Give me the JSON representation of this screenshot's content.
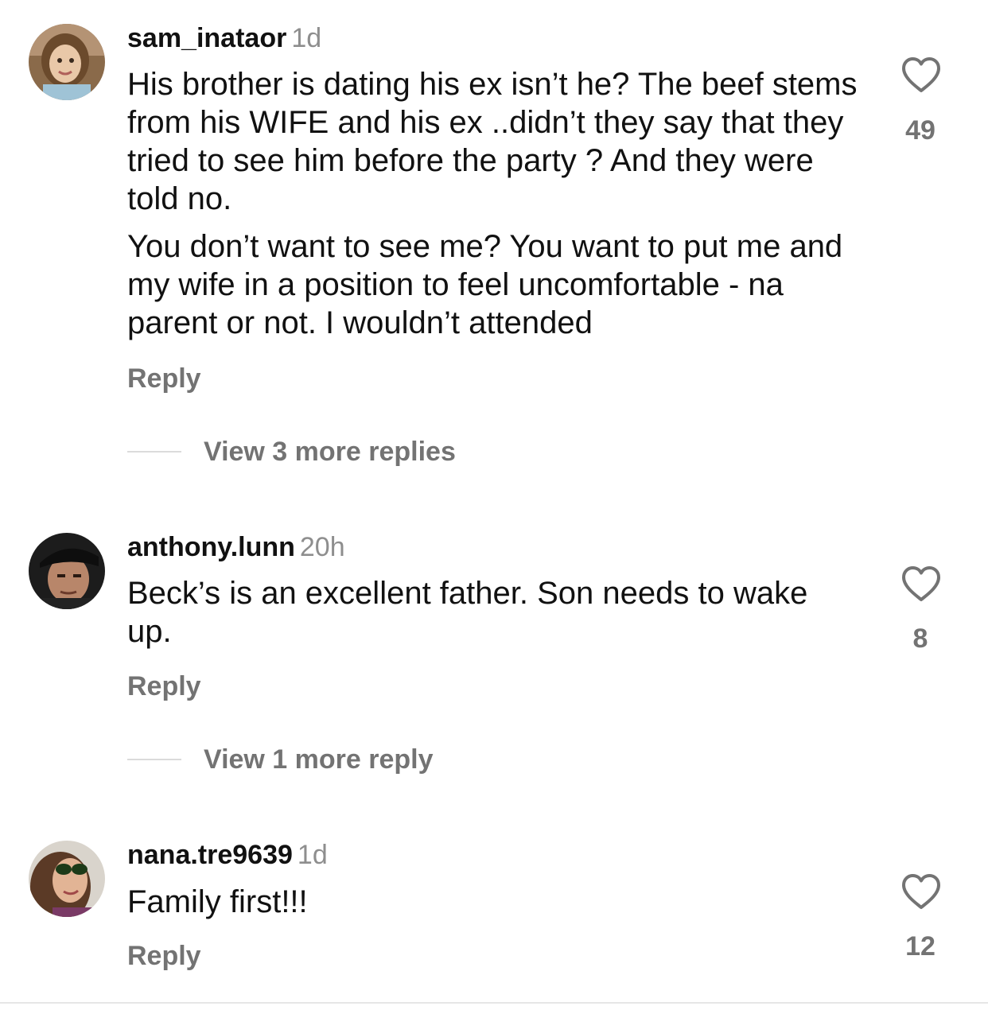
{
  "comments": [
    {
      "avatar_icon": "avatar-photo-child",
      "username": "sam_inataor",
      "time": "1d",
      "paragraphs": [
        "His brother is dating his ex isn’t he? The beef stems from his WIFE and his ex ..didn’t they say that they tried to see him before the party ? And they were told no.",
        "You don’t want to see me? You want to put me and my wife in a position to feel uncomfortable - na parent or not. I wouldn’t attended"
      ],
      "reply_label": "Reply",
      "like_icon": "heart-outline-icon",
      "likes": "49",
      "more_replies_label": "View 3 more replies"
    },
    {
      "avatar_icon": "avatar-photo-man-cap",
      "username": "anthony.lunn",
      "time": "20h",
      "paragraphs": [
        "Beck’s is an excellent father. Son needs to wake up."
      ],
      "reply_label": "Reply",
      "like_icon": "heart-outline-icon",
      "likes": "8",
      "more_replies_label": "View 1 more reply"
    },
    {
      "avatar_icon": "avatar-photo-woman-sunglasses",
      "username": "nana.tre9639",
      "time": "1d",
      "paragraphs": [
        "Family first!!!"
      ],
      "reply_label": "Reply",
      "like_icon": "heart-outline-icon",
      "likes": "12"
    }
  ],
  "colors": {
    "primary_text": "#111111",
    "secondary_text": "#737373",
    "timestamp": "#8e8e8e",
    "divider": "#dbdbdb"
  }
}
